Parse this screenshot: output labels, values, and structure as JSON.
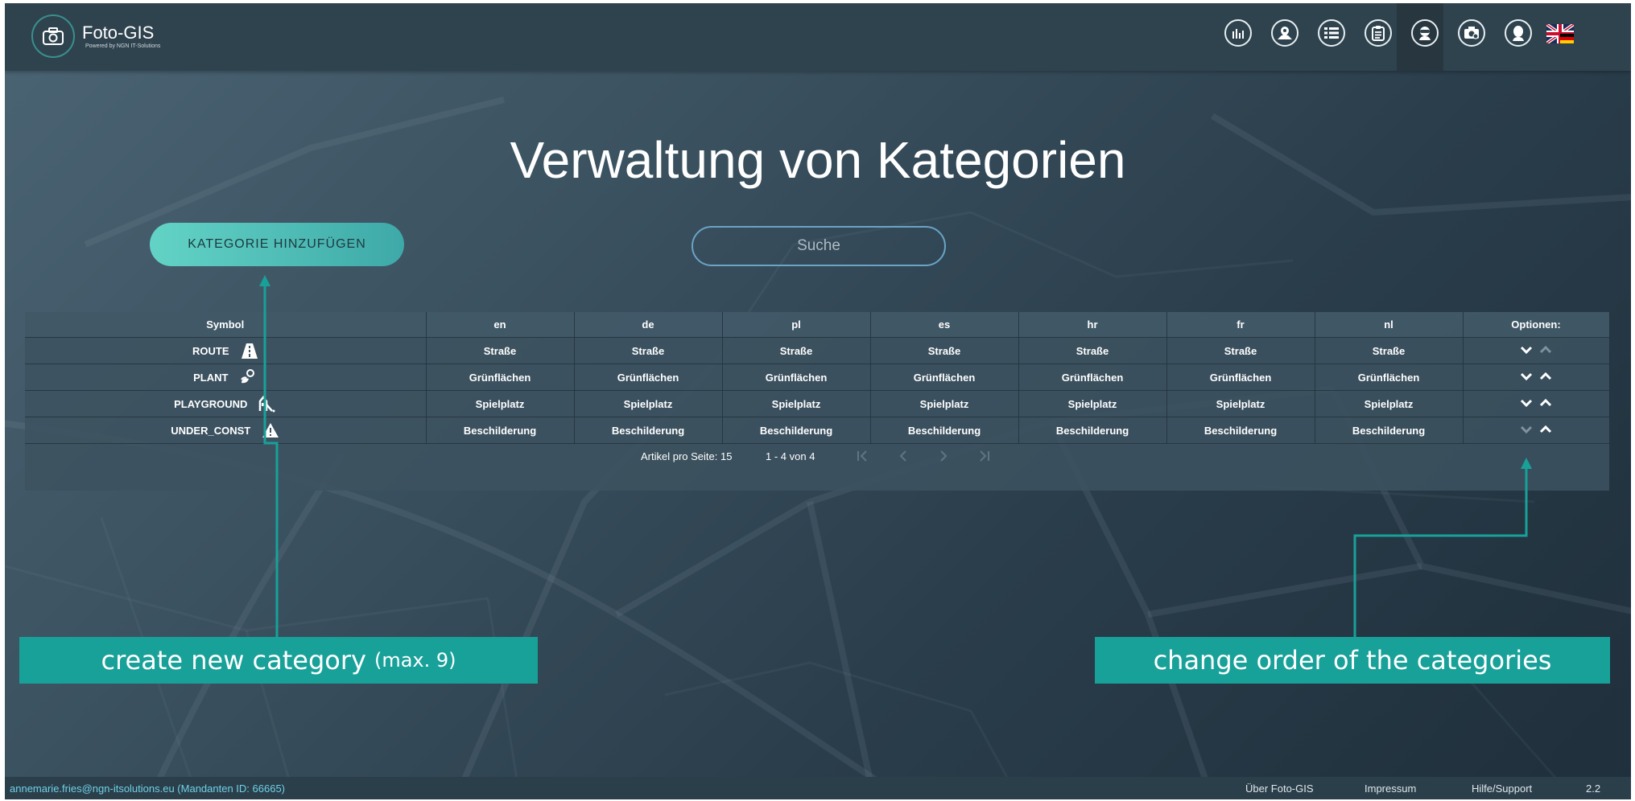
{
  "app": {
    "logo_title": "Foto-GIS",
    "logo_subtitle": "Powered by NGN IT-Solutions",
    "nav_icons": [
      "statistics-icon",
      "map-photo-icon",
      "list-icon",
      "clipboard-icon",
      "user-management-icon",
      "camera-settings-icon",
      "profile-icon",
      "flag-de-uk-icon"
    ]
  },
  "page": {
    "title": "Verwaltung von Kategorien",
    "add_button": "KATEGORIE HINZUFÜGEN",
    "search_placeholder": "Suche"
  },
  "table": {
    "headers": [
      "Symbol",
      "en",
      "de",
      "pl",
      "es",
      "hr",
      "fr",
      "nl",
      "Optionen:"
    ],
    "rows": [
      {
        "symbol": "ROUTE",
        "icon": "road-icon",
        "en": "Straße",
        "de": "Straße",
        "pl": "Straße",
        "es": "Straße",
        "hr": "Straße",
        "fr": "Straße",
        "nl": "Straße",
        "down_enabled": true,
        "up_enabled": false
      },
      {
        "symbol": "PLANT",
        "icon": "plant-icon",
        "en": "Grünflächen",
        "de": "Grünflächen",
        "pl": "Grünflächen",
        "es": "Grünflächen",
        "hr": "Grünflächen",
        "fr": "Grünflächen",
        "nl": "Grünflächen",
        "down_enabled": true,
        "up_enabled": true
      },
      {
        "symbol": "PLAYGROUND",
        "icon": "playground-icon",
        "en": "Spielplatz",
        "de": "Spielplatz",
        "pl": "Spielplatz",
        "es": "Spielplatz",
        "hr": "Spielplatz",
        "fr": "Spielplatz",
        "nl": "Spielplatz",
        "down_enabled": true,
        "up_enabled": true
      },
      {
        "symbol": "UNDER_CONST",
        "icon": "construction-icon",
        "en": "Beschilderung",
        "de": "Beschilderung",
        "pl": "Beschilderung",
        "es": "Beschilderung",
        "hr": "Beschilderung",
        "fr": "Beschilderung",
        "nl": "Beschilderung",
        "down_enabled": false,
        "up_enabled": true
      }
    ]
  },
  "paginator": {
    "items_per_page": "Artikel pro Seite: 15",
    "range": "1 - 4 von 4"
  },
  "annotations": {
    "left_main": "create new category",
    "left_small": "(max. 9)",
    "right": "change order of the categories"
  },
  "footer": {
    "user": "annemarie.fries@ngn-itsolutions.eu (Mandanten ID: 66665)",
    "about": "Über Foto-GIS",
    "impressum": "Impressum",
    "help": "Hilfe/Support",
    "version": "2.2"
  },
  "colors": {
    "accent": "#18a199",
    "button_gradient_start": "#63d3c6",
    "button_gradient_end": "#3ea9a8",
    "topbar": "#2f434f"
  }
}
